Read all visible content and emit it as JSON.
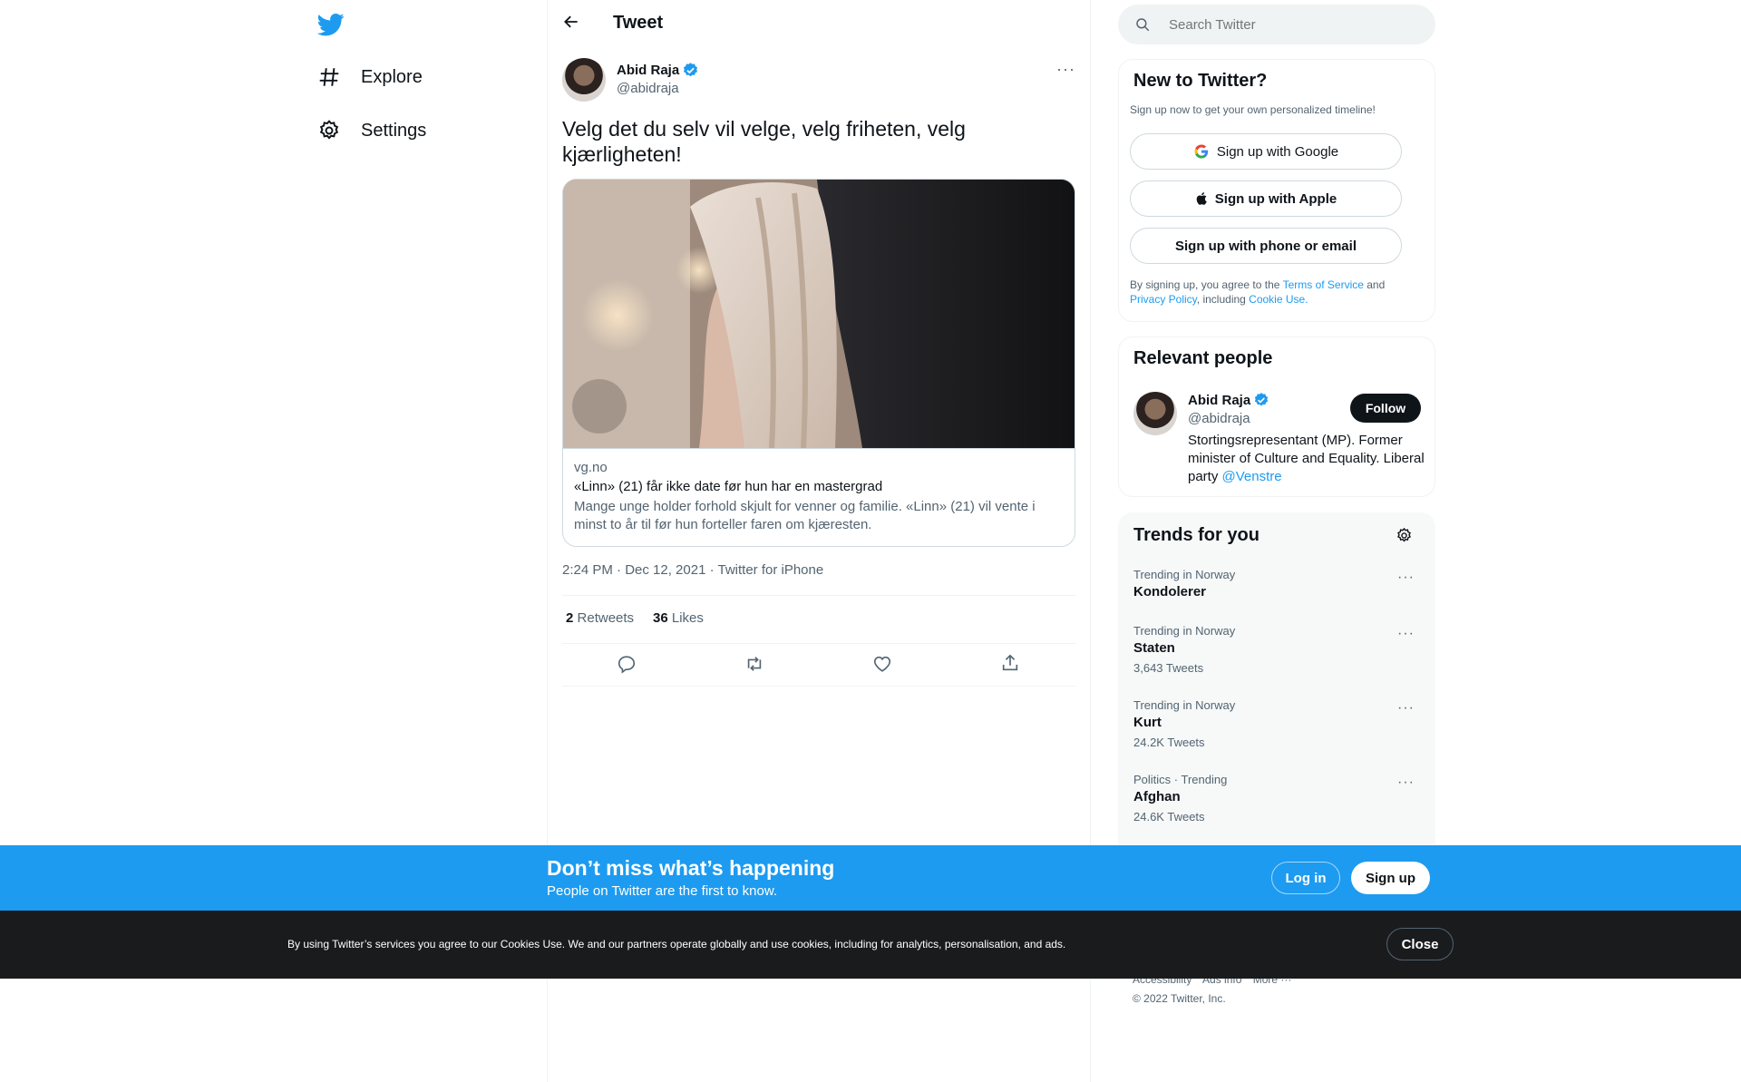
{
  "nav": {
    "logo": "twitter-bird-icon",
    "items": [
      {
        "label": "Explore",
        "icon": "hashtag-icon"
      },
      {
        "label": "Settings",
        "icon": "gear-icon"
      }
    ]
  },
  "header": {
    "title": "Tweet"
  },
  "tweet": {
    "author_name": "Abid Raja",
    "author_handle": "@abidraja",
    "text": "Velg det du selv vil velge, velg friheten, velg kjærligheten!",
    "card": {
      "domain": "vg.no",
      "title": "«Linn» (21) får ikke date før hun har en mastergrad",
      "description": "Mange unge holder forhold skjult for venner og familie. «Linn» (21) vil vente i minst to år til før hun forteller faren om kjæresten."
    },
    "timestamp": "2:24 PM · Dec 12, 2021 · Twitter for iPhone",
    "retweets_count": "2",
    "retweets_label": "Retweets",
    "likes_count": "36",
    "likes_label": "Likes"
  },
  "search": {
    "placeholder": "Search Twitter"
  },
  "signup_panel": {
    "title": "New to Twitter?",
    "subtitle": "Sign up now to get your own personalized timeline!",
    "google_label": "Sign up with Google",
    "apple_label": "Sign up with Apple",
    "phone_label": "Sign up with phone or email",
    "legal_prefix": "By signing up, you agree to the ",
    "terms": "Terms of Service",
    "and": " and",
    "privacy": "Privacy Policy",
    "including": ", including ",
    "cookie_use": "Cookie Use."
  },
  "relevant_people": {
    "title": "Relevant people",
    "name": "Abid Raja",
    "handle": "@abidraja",
    "follow_label": "Follow",
    "bio": "Stortingsrepresentant (MP). Former minister of Culture and Equality. Liberal party ",
    "bio_link": "@Venstre"
  },
  "trends": {
    "title": "Trends for you",
    "items": [
      {
        "context": "Trending in Norway",
        "name": "Kondolerer",
        "count": ""
      },
      {
        "context": "Trending in Norway",
        "name": "Staten",
        "count": "3,643 Tweets"
      },
      {
        "context": "Trending in Norway",
        "name": "Kurt",
        "count": "24.2K Tweets"
      },
      {
        "context": "Politics · Trending",
        "name": "Afghan",
        "count": "24.6K Tweets"
      }
    ]
  },
  "footer": {
    "links": [
      "Accessibility",
      "Ads info",
      "More ···"
    ],
    "copyright": "© 2022 Twitter, Inc."
  },
  "login_bar": {
    "title": "Don’t miss what’s happening",
    "subtitle": "People on Twitter are the first to know.",
    "login_label": "Log in",
    "signup_label": "Sign up"
  },
  "cookie_bar": {
    "text": "By using Twitter’s services you agree to our Cookies Use. We and our partners operate globally and use cookies, including for analytics, personalisation, and ads.",
    "close_label": "Close"
  },
  "colors": {
    "brand": "#1d9bf0",
    "text": "#0f1419",
    "muted": "#536471",
    "cookie_bg": "#1a1b1d"
  }
}
